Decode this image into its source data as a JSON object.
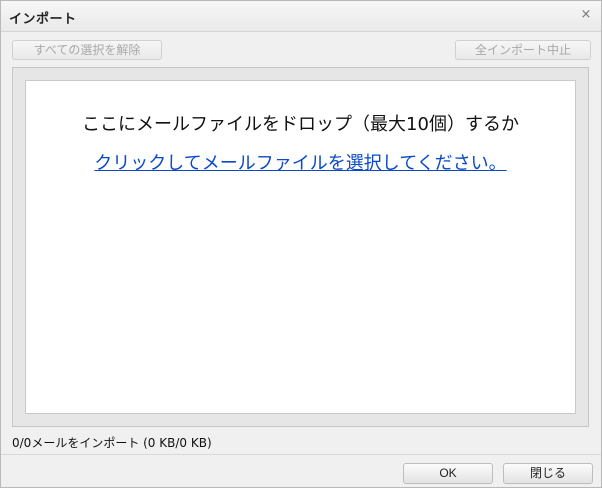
{
  "dialog": {
    "title": "インポート",
    "close_glyph": "×"
  },
  "toolbar": {
    "deselect_all_label": "すべての選択を解除",
    "stop_all_label": "全インポート中止"
  },
  "dropzone": {
    "instruction": "ここにメールファイルをドロップ（最大10個）するか",
    "link_text": "クリックしてメールファイルを選択してください。"
  },
  "status": {
    "text": "0/0メールをインポート (0 KB/0 KB)"
  },
  "footer": {
    "ok_label": "OK",
    "close_label": "閉じる"
  },
  "colors": {
    "link": "#0b49c9",
    "disabled_text": "#a8a8a8"
  },
  "icons": {
    "close": "close-icon"
  }
}
